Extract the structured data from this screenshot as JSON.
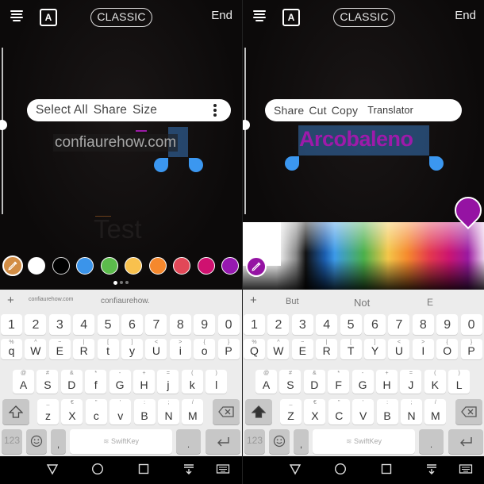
{
  "left": {
    "topbar": {
      "style_label": "CLASSIC",
      "end_label": "End",
      "font_icon_label": "A"
    },
    "context_menu": {
      "items": [
        "Select All",
        "Share",
        "Size"
      ]
    },
    "canvas_text": "confiaurehow.com",
    "background_text": "Test",
    "colors": [
      "#ffffff",
      "#000000",
      "#3b94ea",
      "#5cbc4c",
      "#f8c14e",
      "#f5882d",
      "#e24858",
      "#cf1170",
      "#9619b0"
    ],
    "eyedropper_color": "#d28d45",
    "pager": {
      "pages": 3,
      "current": 1
    },
    "keyboard": {
      "suggestions": [
        "confiaurehow.com",
        "confiaurehow."
      ],
      "number_row": [
        "1",
        "2",
        "3",
        "4",
        "5",
        "6",
        "7",
        "8",
        "9",
        "0"
      ],
      "row1": [
        {
          "h": "%",
          "k": "q"
        },
        {
          "h": "^",
          "k": "W"
        },
        {
          "h": "~",
          "k": "E"
        },
        {
          "h": "|",
          "k": "R"
        },
        {
          "h": "[",
          "k": "t"
        },
        {
          "h": "]",
          "k": "y"
        },
        {
          "h": "<",
          "k": "U"
        },
        {
          "h": ">",
          "k": "i"
        },
        {
          "h": "{",
          "k": "o"
        },
        {
          "h": "}",
          "k": "P"
        }
      ],
      "row2": [
        {
          "h": "@",
          "k": "A"
        },
        {
          "h": "#",
          "k": "S"
        },
        {
          "h": "&",
          "k": "D"
        },
        {
          "h": "*",
          "k": "f"
        },
        {
          "h": "-",
          "k": "G"
        },
        {
          "h": "+",
          "k": "H"
        },
        {
          "h": "=",
          "k": "j"
        },
        {
          "h": "(",
          "k": "k"
        },
        {
          "h": ")",
          "k": "l"
        }
      ],
      "row3": [
        {
          "h": "_",
          "k": "z"
        },
        {
          "h": "€",
          "k": "X"
        },
        {
          "h": "\"",
          "k": "c"
        },
        {
          "h": "'",
          "k": "v"
        },
        {
          "h": ":",
          "k": "B"
        },
        {
          "h": ";",
          "k": "N"
        },
        {
          "h": "/",
          "k": "M"
        }
      ],
      "numbers_label": "123",
      "space_label": "SwiftKey",
      "comma_label": ",",
      "period_label": "."
    }
  },
  "right": {
    "topbar": {
      "style_label": "CLASSIC",
      "end_label": "End",
      "font_icon_label": "A"
    },
    "context_menu": {
      "items": [
        "Share",
        "Cut",
        "Copy",
        "Translator"
      ]
    },
    "canvas_text": "Arcobaleno",
    "selected_color": "#9513a3",
    "keyboard": {
      "suggestions": [
        "But",
        "Not",
        "E"
      ],
      "number_row": [
        "1",
        "2",
        "3",
        "4",
        "5",
        "6",
        "7",
        "8",
        "9",
        "0"
      ],
      "row1": [
        {
          "h": "%",
          "k": "Q"
        },
        {
          "h": "^",
          "k": "W"
        },
        {
          "h": "~",
          "k": "E"
        },
        {
          "h": "|",
          "k": "R"
        },
        {
          "h": "[",
          "k": "T"
        },
        {
          "h": "]",
          "k": "Y"
        },
        {
          "h": "<",
          "k": "U"
        },
        {
          "h": ">",
          "k": "I"
        },
        {
          "h": "{",
          "k": "O"
        },
        {
          "h": "}",
          "k": "P"
        }
      ],
      "row2": [
        {
          "h": "@",
          "k": "A"
        },
        {
          "h": "#",
          "k": "S"
        },
        {
          "h": "&",
          "k": "D"
        },
        {
          "h": "*",
          "k": "F"
        },
        {
          "h": "-",
          "k": "G"
        },
        {
          "h": "+",
          "k": "H"
        },
        {
          "h": "=",
          "k": "J"
        },
        {
          "h": "(",
          "k": "K"
        },
        {
          "h": ")",
          "k": "L"
        }
      ],
      "row3": [
        {
          "h": "_",
          "k": "Z"
        },
        {
          "h": "€",
          "k": "X"
        },
        {
          "h": "\"",
          "k": "C"
        },
        {
          "h": "'",
          "k": "V"
        },
        {
          "h": ":",
          "k": "B"
        },
        {
          "h": ";",
          "k": "N"
        },
        {
          "h": "/",
          "k": "M"
        }
      ],
      "numbers_label": "123",
      "space_label": "SwiftKey",
      "comma_label": ",",
      "period_label": "."
    }
  }
}
